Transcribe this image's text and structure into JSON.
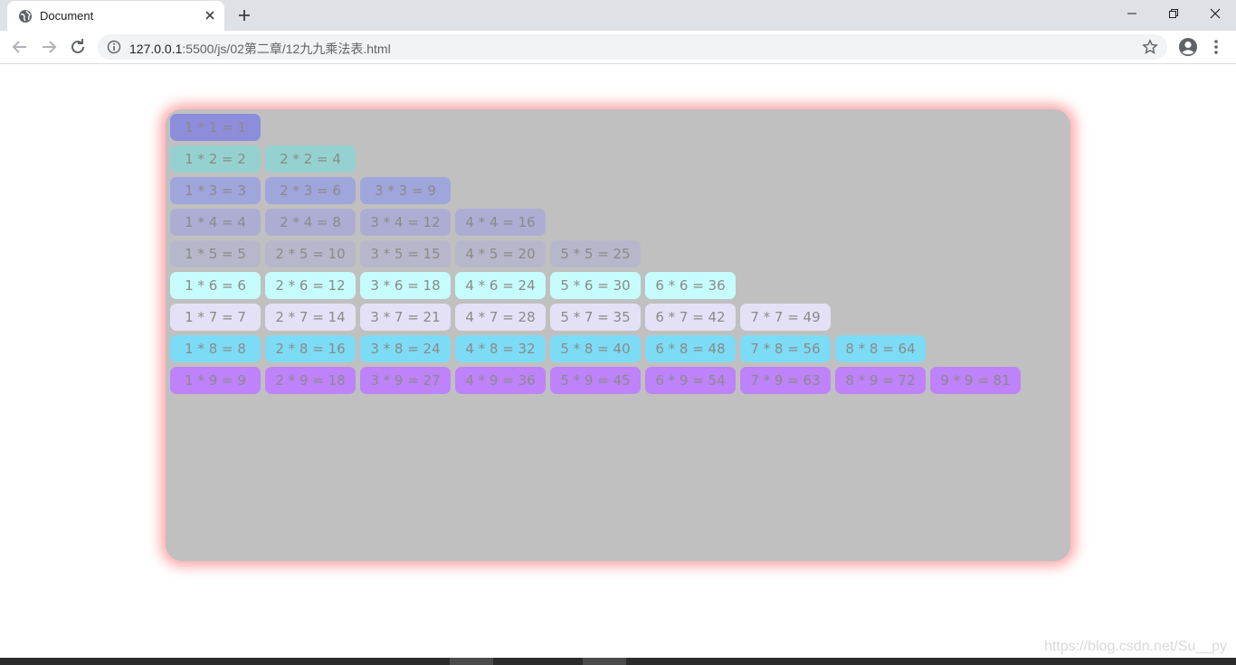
{
  "browser": {
    "tab_title": "Document",
    "url_host": "127.0.0.1",
    "url_rest": ":5500/js/02第二章/12九九乘法表.html"
  },
  "table": {
    "row_colors": [
      "#8c8edb",
      "#96d1d1",
      "#9fa6db",
      "#adadd4",
      "#b7b7cc",
      "#c6fcfc",
      "#e4e1f6",
      "#7cdcf6",
      "#be82fa"
    ],
    "rows": [
      [
        "1 * 1 = 1"
      ],
      [
        "1 * 2 = 2",
        "2 * 2 = 4"
      ],
      [
        "1 * 3 = 3",
        "2 * 3 = 6",
        "3 * 3 = 9"
      ],
      [
        "1 * 4 = 4",
        "2 * 4 = 8",
        "3 * 4 = 12",
        "4 * 4 = 16"
      ],
      [
        "1 * 5 = 5",
        "2 * 5 = 10",
        "3 * 5 = 15",
        "4 * 5 = 20",
        "5 * 5 = 25"
      ],
      [
        "1 * 6 = 6",
        "2 * 6 = 12",
        "3 * 6 = 18",
        "4 * 6 = 24",
        "5 * 6 = 30",
        "6 * 6 = 36"
      ],
      [
        "1 * 7 = 7",
        "2 * 7 = 14",
        "3 * 7 = 21",
        "4 * 7 = 28",
        "5 * 7 = 35",
        "6 * 7 = 42",
        "7 * 7 = 49"
      ],
      [
        "1 * 8 = 8",
        "2 * 8 = 16",
        "3 * 8 = 24",
        "4 * 8 = 32",
        "5 * 8 = 40",
        "6 * 8 = 48",
        "7 * 8 = 56",
        "8 * 8 = 64"
      ],
      [
        "1 * 9 = 9",
        "2 * 9 = 18",
        "3 * 9 = 27",
        "4 * 9 = 36",
        "5 * 9 = 45",
        "6 * 9 = 54",
        "7 * 9 = 63",
        "8 * 9 = 72",
        "9 * 9 = 81"
      ]
    ]
  },
  "watermark": "https://blog.csdn.net/Su__py"
}
